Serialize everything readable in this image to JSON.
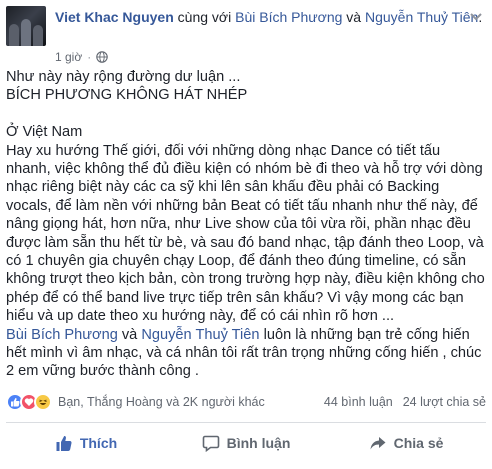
{
  "post": {
    "author": "Viet Khac Nguyen",
    "with_text": "cùng với",
    "tag1": "Bùi Bích Phương",
    "and_text": "và",
    "tag2": "Nguyễn Thuỷ Tiên",
    "tag_end": ".",
    "time": "1 giờ",
    "dot": "·",
    "body": {
      "l1": "Như này này rộng đường dư luận ...",
      "l2": "BÍCH PHƯƠNG KHÔNG HÁT NHÉP",
      "l3": "Ở Việt Nam",
      "para": "Hay xu hướng Thế giới, đối với những dòng nhạc Dance có tiết tấu nhanh, việc không thể đủ điều kiện có nhóm bè đi theo và hỗ trợ với dòng nhạc riêng biệt này các ca sỹ khi lên sân khấu đều phải có Backing vocals, để làm nền với những bản Beat có tiết tấu nhanh như thế này, để nâng giọng hát, hơn nữa, như Live show của tôi vừa rồi, phần nhạc đều được làm sẵn thu hết từ bè, và sau đó band nhạc, tập đánh theo Loop, và có 1 chuyên gia chuyên chạy Loop, để đánh theo đúng timeline, có sẵn không trượt theo kịch bản, còn trong trường hợp này, điều kiện không cho phép để có thể band live trực tiếp trên sân khấu? Vì vậy mong các bạn hiểu và up date theo xu hướng này, để có cái nhìn rõ hơn ...",
      "end_link1": "Bùi Bích Phương",
      "end_and": " và ",
      "end_link2": "Nguyễn Thuỷ Tiên",
      "end_rest": " luôn là những bạn trẻ cống hiến hết mình vì âm nhạc, và cá nhân tôi rất trân trọng những cống hiến , chúc 2 em vững bước thành công ."
    }
  },
  "stats": {
    "reactors": "Bạn, Thắng Hoàng và 2K người khác",
    "comments": "44 bình luận",
    "shares": "24 lượt chia sẻ"
  },
  "actions": {
    "like": "Thích",
    "comment": "Bình luận",
    "share": "Chia sẻ"
  },
  "colors": {
    "link": "#365899",
    "liked": "#4267b2",
    "like_reaction": "#4c82f7",
    "love_reaction": "#f25268",
    "haha_reaction": "#f7c945"
  },
  "icons": [
    "globe-icon",
    "chevron-down-icon",
    "like-reaction-icon",
    "love-reaction-icon",
    "haha-reaction-icon",
    "thumbs-up-icon",
    "comment-icon",
    "share-icon"
  ]
}
